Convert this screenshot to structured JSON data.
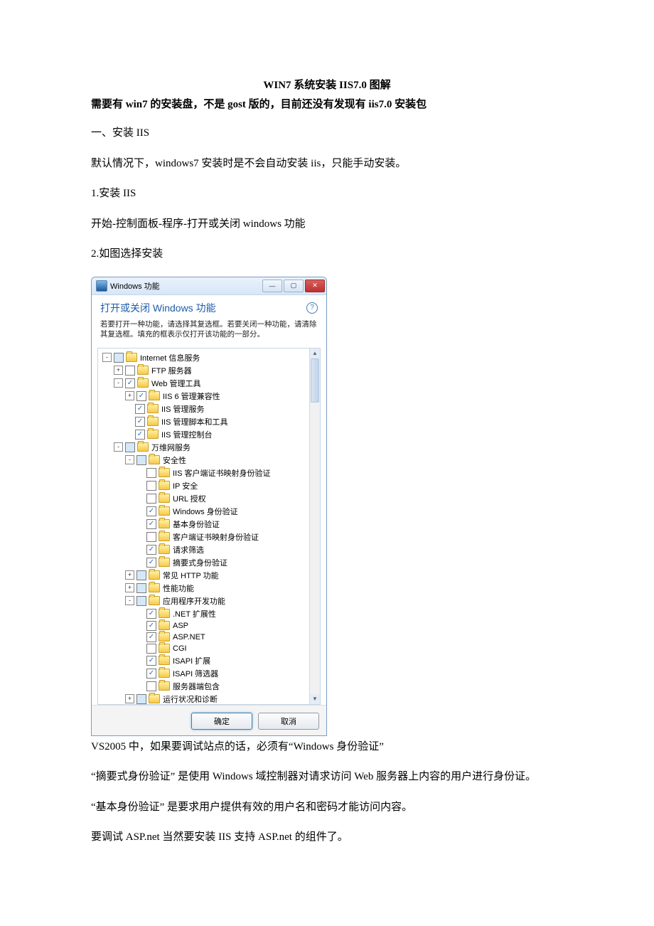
{
  "doc": {
    "title": "WIN7 系统安装 IIS7.0 图解",
    "subtitle_bold": "需要有 win7 的安装盘，不是 gost 版的，目前还没有发现有 iis7.0 安装包",
    "para1": "一、安装 IIS",
    "para2": "默认情况下，windows7 安装时是不会自动安装 iis，只能手动安装。",
    "para3": "1.安装 IIS",
    "para4": "开始-控制面板-程序-打开或关闭 windows 功能",
    "para5": "2.如图选择安装",
    "after1": "VS2005 中，如果要调试站点的话，必须有“Windows 身份验证”",
    "after2": "“摘要式身份验证” 是使用 Windows 域控制器对请求访问 Web 服务器上内容的用户进行身份证。",
    "after3": "“基本身份验证” 是要求用户提供有效的用户名和密码才能访问内容。",
    "after4": "要调试 ASP.net 当然要安装 IIS 支持 ASP.net 的组件了。"
  },
  "dialog": {
    "app_title": "Windows 功能",
    "header_title": "打开或关闭 Windows 功能",
    "help_label": "?",
    "header_desc": "若要打开一种功能，请选择其复选框。若要关闭一种功能，请清除其复选框。填充的框表示仅打开该功能的一部分。",
    "ok_label": "确定",
    "cancel_label": "取消",
    "titlebar_min": "—",
    "titlebar_max": "▢",
    "titlebar_close": "✕",
    "scroll_up": "▲",
    "scroll_down": "▼"
  },
  "tree": [
    {
      "level": 0,
      "toggle": "-",
      "check": "part",
      "label": "Internet 信息服务"
    },
    {
      "level": 1,
      "toggle": "+",
      "check": "none",
      "label": "FTP 服务器"
    },
    {
      "level": 1,
      "toggle": "-",
      "check": "checked",
      "label": "Web 管理工具"
    },
    {
      "level": 2,
      "toggle": "+",
      "check": "checked",
      "label": "IIS 6 管理兼容性"
    },
    {
      "level": 2,
      "toggle": "",
      "check": "checked",
      "label": "IIS 管理服务"
    },
    {
      "level": 2,
      "toggle": "",
      "check": "checked",
      "label": "IIS 管理脚本和工具"
    },
    {
      "level": 2,
      "toggle": "",
      "check": "checked",
      "label": "IIS 管理控制台"
    },
    {
      "level": 1,
      "toggle": "-",
      "check": "part",
      "label": "万维网服务"
    },
    {
      "level": 2,
      "toggle": "-",
      "check": "part",
      "label": "安全性"
    },
    {
      "level": 3,
      "toggle": "",
      "check": "none",
      "label": "IIS 客户端证书映射身份验证"
    },
    {
      "level": 3,
      "toggle": "",
      "check": "none",
      "label": "IP 安全"
    },
    {
      "level": 3,
      "toggle": "",
      "check": "none",
      "label": "URL 授权"
    },
    {
      "level": 3,
      "toggle": "",
      "check": "checked",
      "label": "Windows 身份验证"
    },
    {
      "level": 3,
      "toggle": "",
      "check": "checked",
      "label": "基本身份验证"
    },
    {
      "level": 3,
      "toggle": "",
      "check": "none",
      "label": "客户端证书映射身份验证"
    },
    {
      "level": 3,
      "toggle": "",
      "check": "checked",
      "label": "请求筛选"
    },
    {
      "level": 3,
      "toggle": "",
      "check": "checked",
      "label": "摘要式身份验证"
    },
    {
      "level": 2,
      "toggle": "+",
      "check": "part",
      "label": "常见 HTTP 功能"
    },
    {
      "level": 2,
      "toggle": "+",
      "check": "part",
      "label": "性能功能"
    },
    {
      "level": 2,
      "toggle": "-",
      "check": "part",
      "label": "应用程序开发功能"
    },
    {
      "level": 3,
      "toggle": "",
      "check": "checked",
      "label": ".NET 扩展性"
    },
    {
      "level": 3,
      "toggle": "",
      "check": "checked",
      "label": "ASP"
    },
    {
      "level": 3,
      "toggle": "",
      "check": "checked",
      "label": "ASP.NET"
    },
    {
      "level": 3,
      "toggle": "",
      "check": "none",
      "label": "CGI"
    },
    {
      "level": 3,
      "toggle": "",
      "check": "checked",
      "label": "ISAPI 扩展"
    },
    {
      "level": 3,
      "toggle": "",
      "check": "checked",
      "label": "ISAPI 筛选器"
    },
    {
      "level": 3,
      "toggle": "",
      "check": "none",
      "label": "服务器端包含"
    },
    {
      "level": 2,
      "toggle": "+",
      "check": "part",
      "label": "运行状况和诊断"
    }
  ]
}
